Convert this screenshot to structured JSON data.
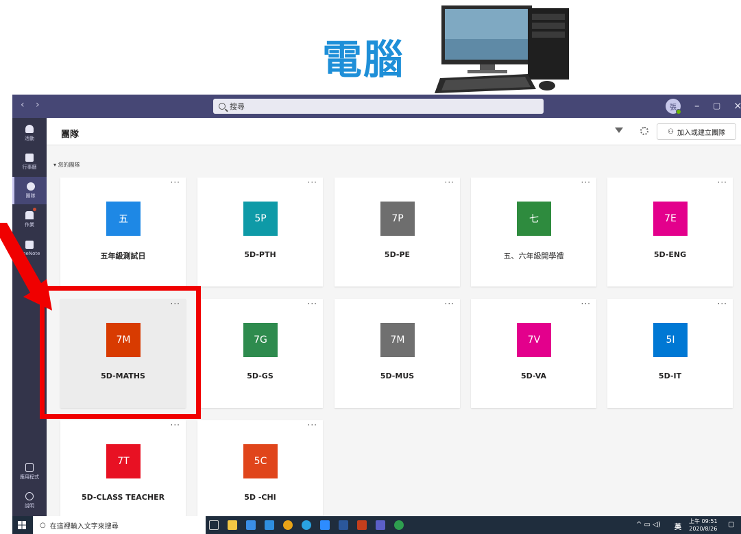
{
  "banner": {
    "title": "電腦"
  },
  "titlebar": {
    "search_placeholder": "搜尋",
    "avatar_initial": "張"
  },
  "rail": {
    "items": [
      {
        "label": "活動"
      },
      {
        "label": "行事曆"
      },
      {
        "label": "團隊"
      },
      {
        "label": "作業"
      },
      {
        "label": "OneNote"
      },
      {
        "label": "..."
      },
      {
        "label": "應用程式"
      },
      {
        "label": "說明"
      }
    ]
  },
  "header": {
    "title": "團隊",
    "join_label": "加入或建立團隊"
  },
  "section": {
    "label": "您的團隊"
  },
  "teams": [
    {
      "tile": "五",
      "name": "五年級測試日",
      "color": "#1e88e5"
    },
    {
      "tile": "5P",
      "name": "5D-PTH",
      "color": "#0e9aa7"
    },
    {
      "tile": "7P",
      "name": "5D-PE",
      "color": "#6e6e6e"
    },
    {
      "tile": "七",
      "name": "五、六年級開學禮",
      "color": "#2e8b3e"
    },
    {
      "tile": "7E",
      "name": "5D-ENG",
      "color": "#e3008c"
    },
    {
      "tile": "7M",
      "name": "5D-MATHS",
      "color": "#d83b01"
    },
    {
      "tile": "7G",
      "name": "5D-GS",
      "color": "#2e8b4e"
    },
    {
      "tile": "7M",
      "name": "5D-MUS",
      "color": "#707070"
    },
    {
      "tile": "7V",
      "name": "5D-VA",
      "color": "#e3008c"
    },
    {
      "tile": "5I",
      "name": "5D-IT",
      "color": "#0078d4"
    },
    {
      "tile": "7T",
      "name": "5D-CLASS TEACHER",
      "color": "#e81123"
    },
    {
      "tile": "5C",
      "name": "5D -CHI",
      "color": "#e0451b"
    }
  ],
  "taskbar": {
    "search_placeholder": "在這裡輸入文字來搜尋",
    "lang": "英",
    "time": "上午 09:51",
    "date": "2020/8/26"
  },
  "colors": {
    "titlebar": "#464775",
    "rail": "#33344a",
    "highlight": "#f00000",
    "banner_text": "#1e8fd8"
  }
}
